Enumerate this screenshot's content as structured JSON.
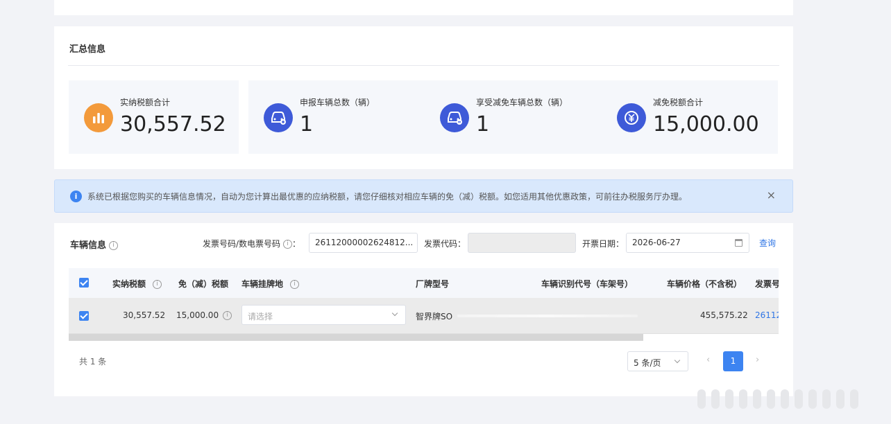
{
  "summary": {
    "title": "汇总信息",
    "stats": [
      {
        "label": "实纳税额合计",
        "value": "30,557.52",
        "color": "#f39a3b"
      },
      {
        "label": "申报车辆总数（辆）",
        "value": "1",
        "color": "#3e5ad8"
      },
      {
        "label": "享受减免车辆总数（辆）",
        "value": "1",
        "color": "#3e5ad8"
      },
      {
        "label": "减免税额合计",
        "value": "15,000.00",
        "color": "#3e5ad8"
      }
    ]
  },
  "alert": {
    "message": "系统已根据您购买的车辆信息情况，自动为您计算出最优惠的应纳税额，请您仔细核对相应车辆的免（减）税额。如您适用其他优惠政策，可前往办税服务厅办理。",
    "close_label": "×"
  },
  "vehicle": {
    "title": "车辆信息",
    "help_glyph": "i",
    "invoice_label": "发票号码/数电票号码",
    "colon": "：",
    "invoice_value": "26112000002624812...",
    "code_label": "发票代码：",
    "code_value": "",
    "date_label": "开票日期：",
    "date_value": "2026-06-27",
    "query_label": "查询"
  },
  "table": {
    "headers": {
      "tax_paid": "实纳税额",
      "tax_exempt": "免（减）税额",
      "plate_place": "车辆挂牌地",
      "model": "厂牌型号",
      "vin": "车辆识别代号（车架号）",
      "price": "车辆价格（不含税）",
      "invoice": "发票号"
    },
    "rows": [
      {
        "tax_paid": "30,557.52",
        "tax_exempt": "15,000.00",
        "plate_placeholder": "请选择",
        "model": "智界牌SO",
        "price": "455,575.22",
        "invoice": "26112"
      }
    ]
  },
  "pagination": {
    "total": "共 1 条",
    "page_size": "5 条/页",
    "prev": "‹",
    "next": "›",
    "current": "1"
  }
}
